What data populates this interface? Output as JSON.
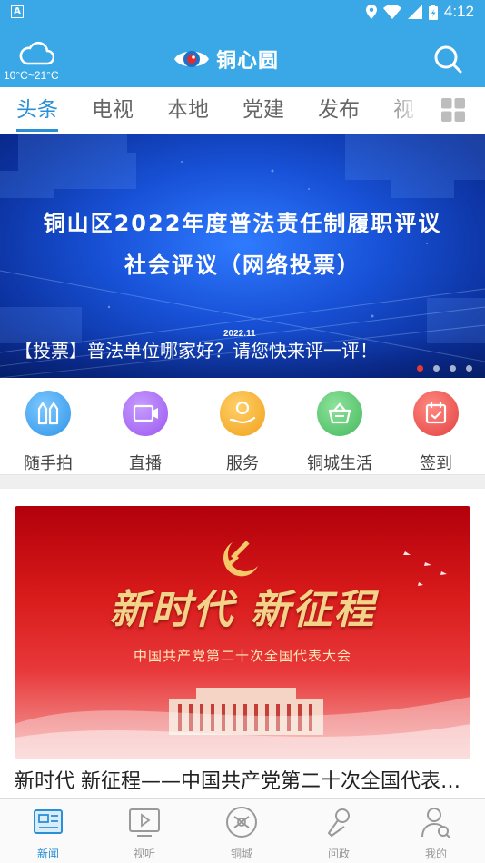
{
  "status_bar": {
    "left_icon": "A",
    "time": "4:12",
    "icons": [
      "location-icon",
      "wifi-icon",
      "signal-icon",
      "battery-icon"
    ]
  },
  "header": {
    "weather": "10°C~21°C",
    "app_name": "铜心圆",
    "weather_icon": "cloud-icon",
    "search_icon": "search-icon"
  },
  "tabs": [
    {
      "label": "头条",
      "active": true
    },
    {
      "label": "电视"
    },
    {
      "label": "本地"
    },
    {
      "label": "党建"
    },
    {
      "label": "发布"
    },
    {
      "label": "视"
    }
  ],
  "banner": {
    "title_line1": "铜山区2022年度普法责任制履职评议",
    "title_line2": "社会评议（网络投票）",
    "date": "2022.11",
    "caption": "【投票】普法单位哪家好？请您快来评一评！",
    "slides": 4,
    "active_slide": 1
  },
  "quick_actions": [
    {
      "label": "随手拍",
      "color": "#3aa6ee",
      "icon": "camera-bottles-icon"
    },
    {
      "label": "直播",
      "color": "#a45ef0",
      "icon": "live-video-icon"
    },
    {
      "label": "服务",
      "color": "#f2a51e",
      "icon": "service-hand-icon"
    },
    {
      "label": "铜城生活",
      "color": "#4bc26a",
      "icon": "shopping-basket-icon"
    },
    {
      "label": "签到",
      "color": "#ea4b4b",
      "icon": "checkin-calendar-icon"
    }
  ],
  "news": {
    "image_slogan": "新时代 新征程",
    "image_subtitle": "中国共产党第二十次全国代表大会",
    "title": "新时代 新征程——中国共产党第二十次全国代表大会"
  },
  "bottom_nav": [
    {
      "label": "新闻",
      "active": true,
      "icon": "news-icon"
    },
    {
      "label": "视听",
      "icon": "video-icon"
    },
    {
      "label": "铜城",
      "icon": "city-logo-icon"
    },
    {
      "label": "问政",
      "icon": "microphone-icon"
    },
    {
      "label": "我的",
      "icon": "profile-icon"
    }
  ],
  "colors": {
    "brand_blue": "#3aa8e6",
    "tab_active": "#2b8fd6",
    "dot_active": "#e53935"
  }
}
